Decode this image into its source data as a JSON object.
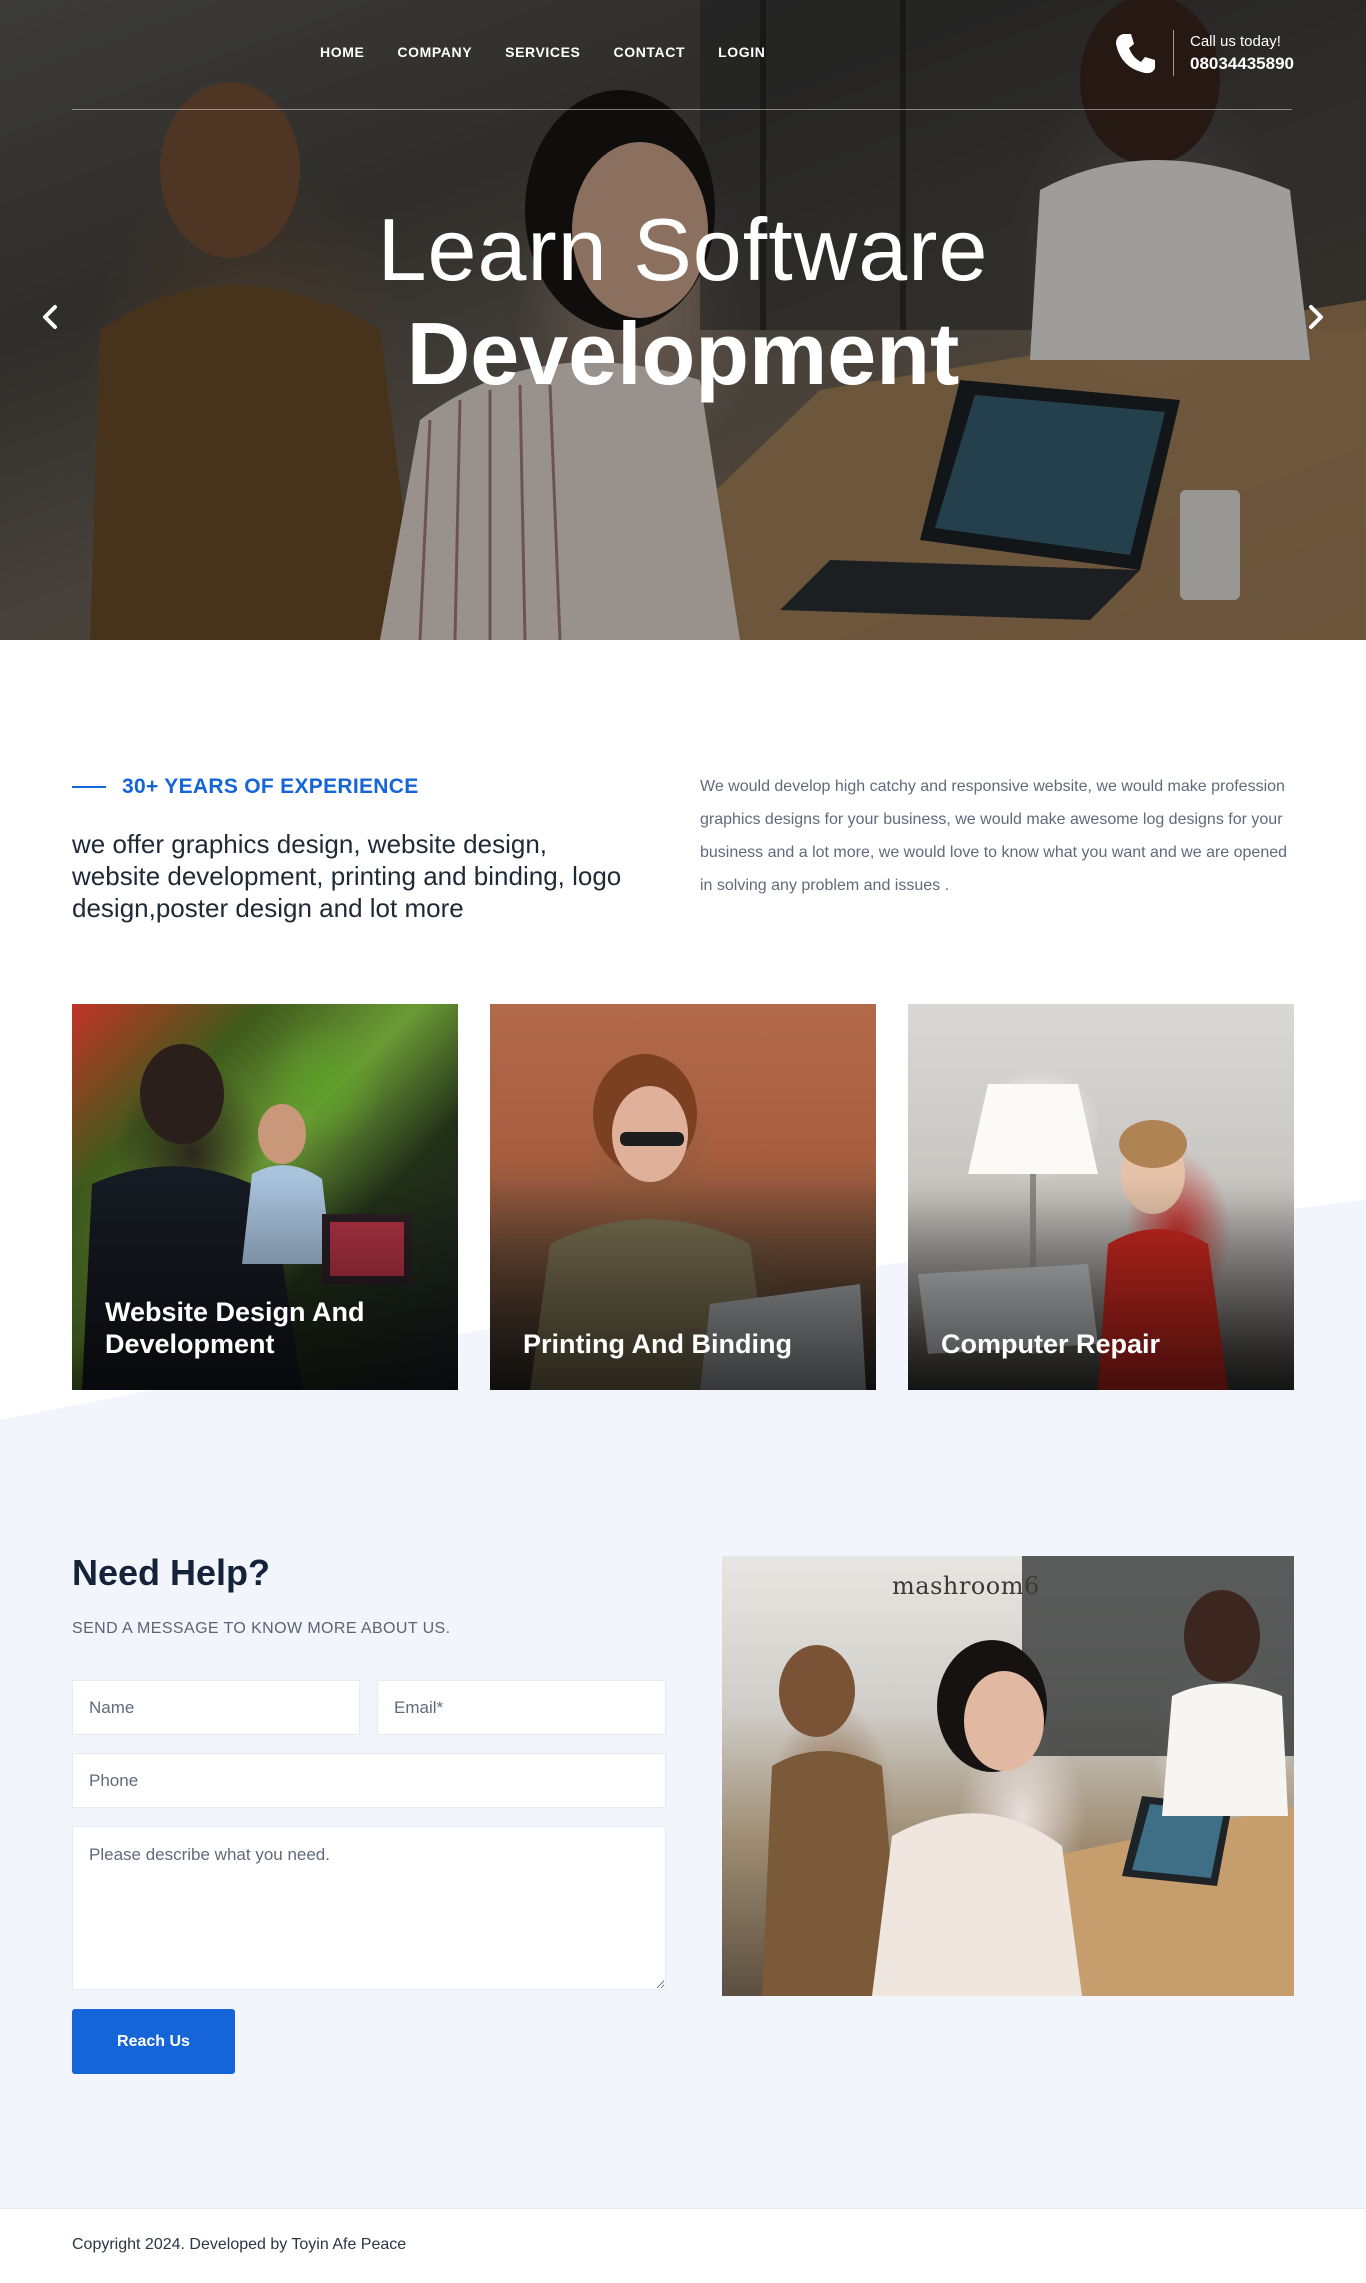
{
  "nav": {
    "items": [
      "HOME",
      "COMPANY",
      "SERVICES",
      "CONTACT",
      "LOGIN"
    ],
    "call_label": "Call us today!",
    "call_number": "08034435890"
  },
  "hero": {
    "line1": "Learn Software",
    "line2": "Development"
  },
  "intro": {
    "eyebrow": "30+ YEARS OF EXPERIENCE",
    "lead": "we offer graphics design, website design, website development, printing and binding, logo design,poster design and lot more",
    "body": "We would develop high catchy and responsive website, we would make profession graphics designs for your business, we would make awesome log designs for your business and a lot more, we would love to know what you want and we are opened in solving any problem and issues ."
  },
  "services": [
    {
      "title": "Website Design And Development"
    },
    {
      "title": "Printing And Binding"
    },
    {
      "title": "Computer Repair"
    }
  ],
  "contact": {
    "title": "Need Help?",
    "subtitle": "SEND A MESSAGE TO KNOW MORE ABOUT US.",
    "name_placeholder": "Name",
    "email_placeholder": "Email*",
    "phone_placeholder": "Phone",
    "message_placeholder": "Please describe what you need.",
    "button": "Reach Us",
    "photo_sign": "mashroom6"
  },
  "footer": {
    "copyright": "Copyright 2024. Developed by Toyin Afe Peace"
  },
  "colors": {
    "accent": "#1565d8",
    "section_bg": "#f2f5fc",
    "heading": "#14233a"
  },
  "icons": {
    "phone": "phone-icon",
    "prev": "chevron-left-icon",
    "next": "chevron-right-icon"
  }
}
